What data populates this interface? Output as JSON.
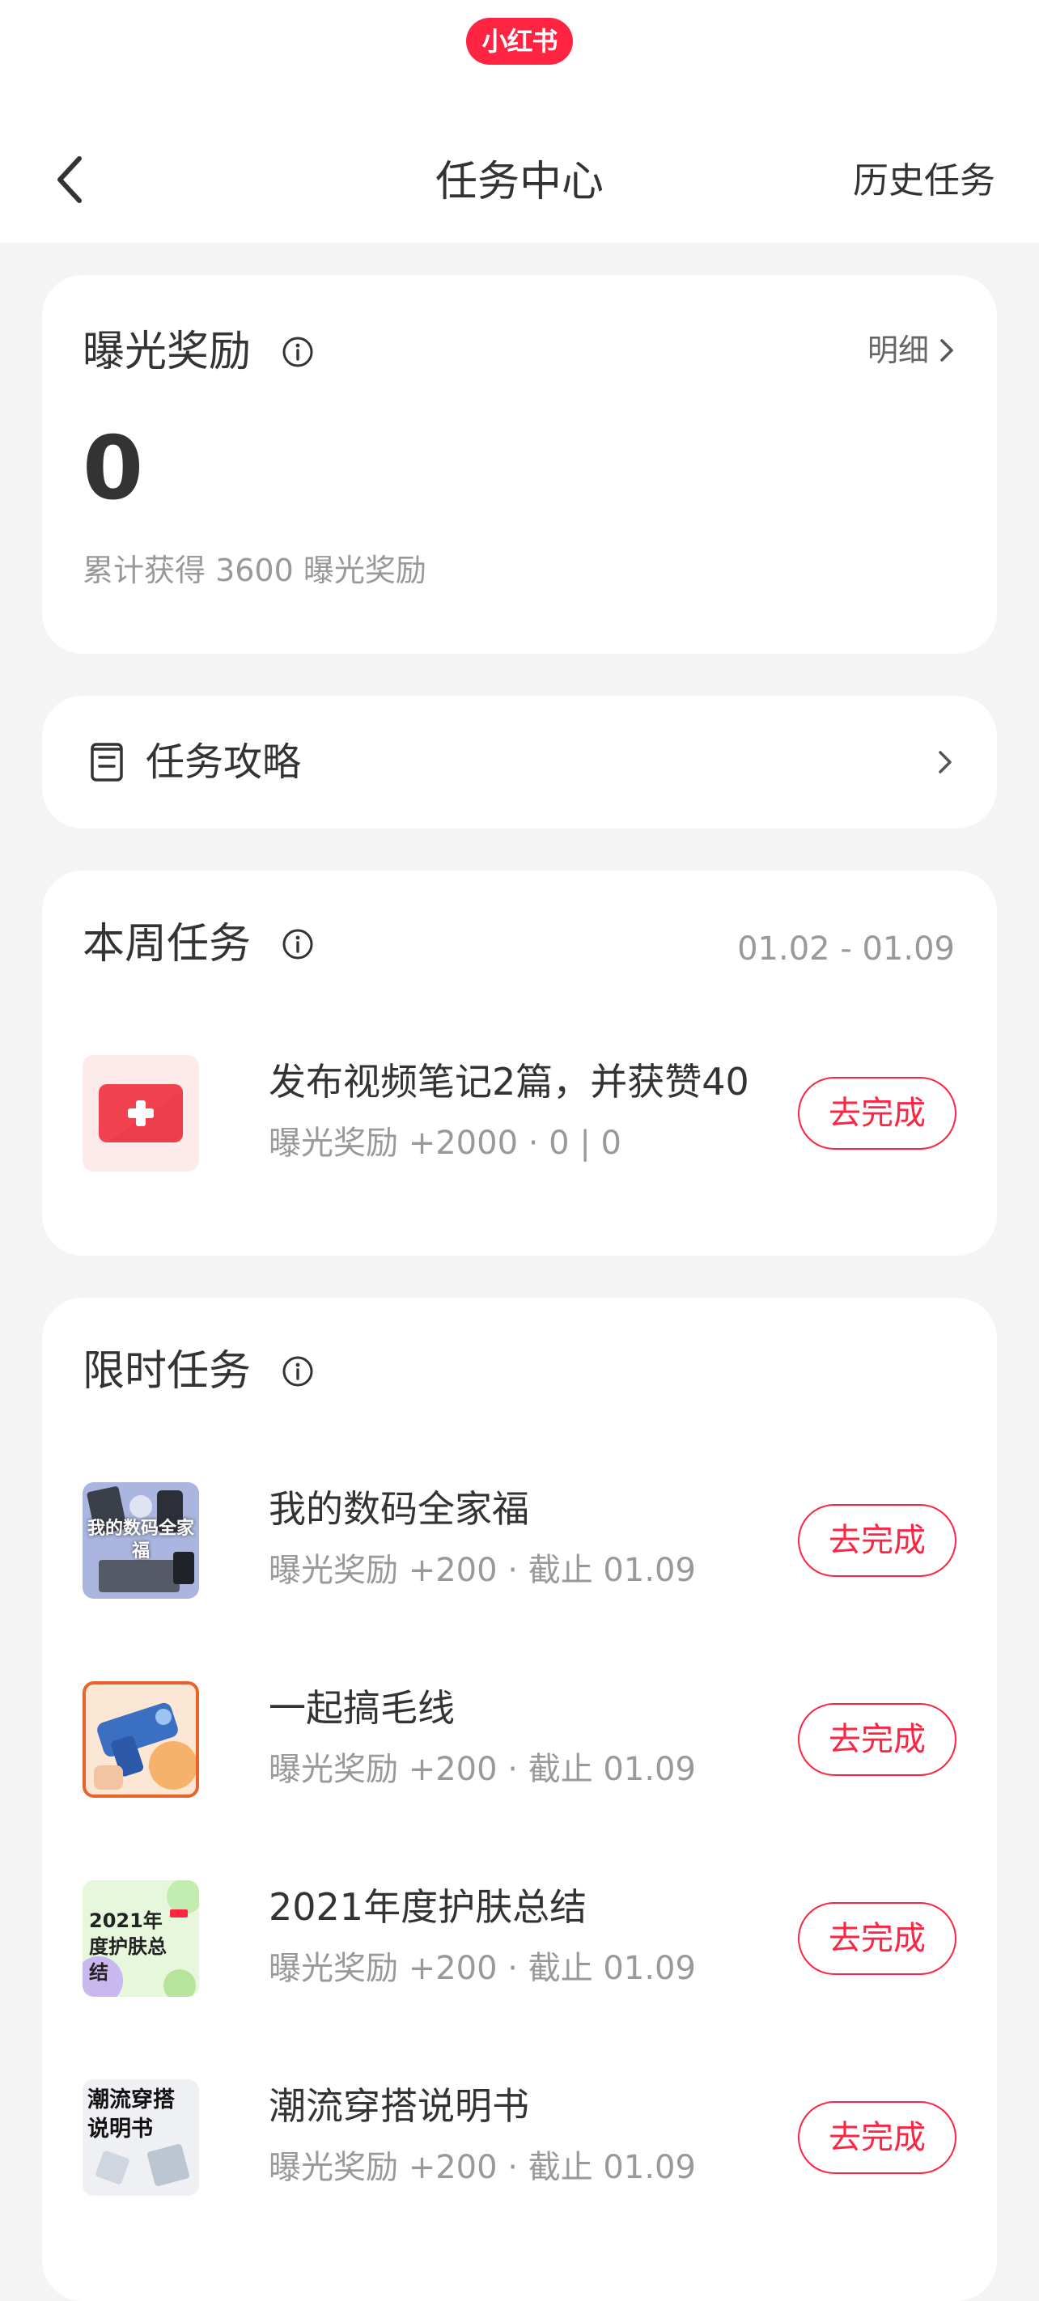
{
  "app": {
    "brand": "小红书"
  },
  "header": {
    "title": "任务中心",
    "history_label": "历史任务"
  },
  "exposure": {
    "title": "曝光奖励",
    "detail_label": "明细",
    "value": "0",
    "cumulative": "累计获得 3600 曝光奖励"
  },
  "guide": {
    "label": "任务攻略"
  },
  "weekly": {
    "title": "本周任务",
    "date_range": "01.02 - 01.09",
    "tasks": [
      {
        "title": "发布视频笔记2篇，并获赞40",
        "meta": "曝光奖励 +2000 · 0 | 0",
        "button": "去完成"
      }
    ]
  },
  "limited": {
    "title": "限时任务",
    "tasks": [
      {
        "title": "我的数码全家福",
        "meta": "曝光奖励 +200 · 截止 01.09",
        "button": "去完成",
        "thumb_text": "我的数码全家福"
      },
      {
        "title": "一起搞毛线",
        "meta": "曝光奖励 +200 · 截止 01.09",
        "button": "去完成"
      },
      {
        "title": "2021年度护肤总结",
        "meta": "曝光奖励 +200 · 截止 01.09",
        "button": "去完成",
        "thumb_text": "2021年度护肤总结"
      },
      {
        "title": "潮流穿搭说明书",
        "meta": "曝光奖励 +200 · 截止 01.09",
        "button": "去完成",
        "thumb_text": "潮流穿搭说明书"
      }
    ]
  },
  "colors": {
    "accent": "#ff2442",
    "background": "#f4f4f4"
  }
}
